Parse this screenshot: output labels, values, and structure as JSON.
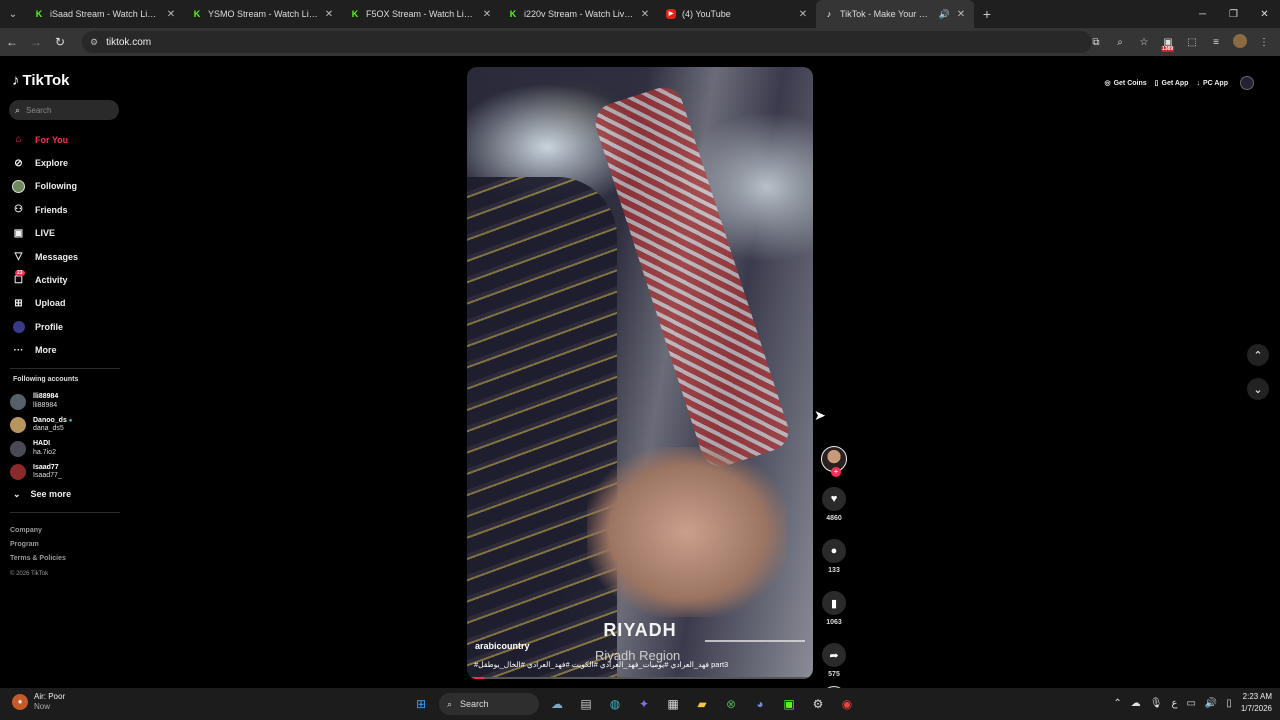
{
  "browser": {
    "tabs": [
      {
        "title": "iSaad Stream - Watch Live on Kick",
        "icon": "kick-icon",
        "close": "✕"
      },
      {
        "title": "YSMO Stream - Watch Live on Kick",
        "icon": "kick-icon",
        "close": "✕"
      },
      {
        "title": "F5OX Stream - Watch Live on Kick",
        "icon": "kick-icon",
        "close": "✕"
      },
      {
        "title": "i220v Stream - Watch Live on Kick",
        "icon": "kick-icon",
        "close": "✕"
      },
      {
        "title": "(4) YouTube",
        "icon": "youtube-icon",
        "close": "✕"
      },
      {
        "title": "TikTok - Make Your Day",
        "icon": "tiktok-icon",
        "close": "✕",
        "active": true
      }
    ],
    "new_tab": "+",
    "url": "tiktok.com",
    "extension_badge": "1389"
  },
  "tiktok": {
    "brand": "TikTok",
    "search_placeholder": "Search",
    "nav": [
      {
        "label": "For You",
        "icon": "home-icon"
      },
      {
        "label": "Explore",
        "icon": "compass-icon"
      },
      {
        "label": "Following",
        "icon": "following-icon"
      },
      {
        "label": "Friends",
        "icon": "friends-icon"
      },
      {
        "label": "LIVE",
        "icon": "live-icon"
      },
      {
        "label": "Messages",
        "icon": "messages-icon"
      },
      {
        "label": "Activity",
        "icon": "activity-icon",
        "badge": "23"
      },
      {
        "label": "Upload",
        "icon": "upload-icon"
      },
      {
        "label": "Profile",
        "icon": "profile-icon"
      },
      {
        "label": "More",
        "icon": "more-icon"
      }
    ],
    "following_title": "Following accounts",
    "following": [
      {
        "name": "lli88984",
        "handle": "lli88984"
      },
      {
        "name": "Danoo_ds",
        "handle": "dana_ds5",
        "verified": true
      },
      {
        "name": "HADI",
        "handle": "ha.7io2"
      },
      {
        "name": "Isaad77",
        "handle": "Isaad77_"
      }
    ],
    "see_more": "See more",
    "footer": {
      "company": "Company",
      "program": "Program",
      "terms": "Terms & Policies",
      "copyright": "© 2026 TikTok"
    },
    "top_actions": {
      "coins": "Get Coins",
      "app": "Get App",
      "pc": "PC App"
    },
    "video": {
      "caption_big": "RIYADH",
      "caption_region": "Riyadh Region",
      "author": "arabicountry",
      "tags": "#فهد_العرادي #يوميات_فهد_العرادي #الكويت #فهد_العرادي #الخال_يوطقل part3"
    },
    "counts": {
      "likes": "4860",
      "comments": "133",
      "saves": "1063",
      "shares": "575"
    }
  },
  "taskbar": {
    "weather_title": "Air: Poor",
    "weather_sub": "Now",
    "search": "Search",
    "time": "2:23 AM",
    "date": "1/7/2026"
  }
}
